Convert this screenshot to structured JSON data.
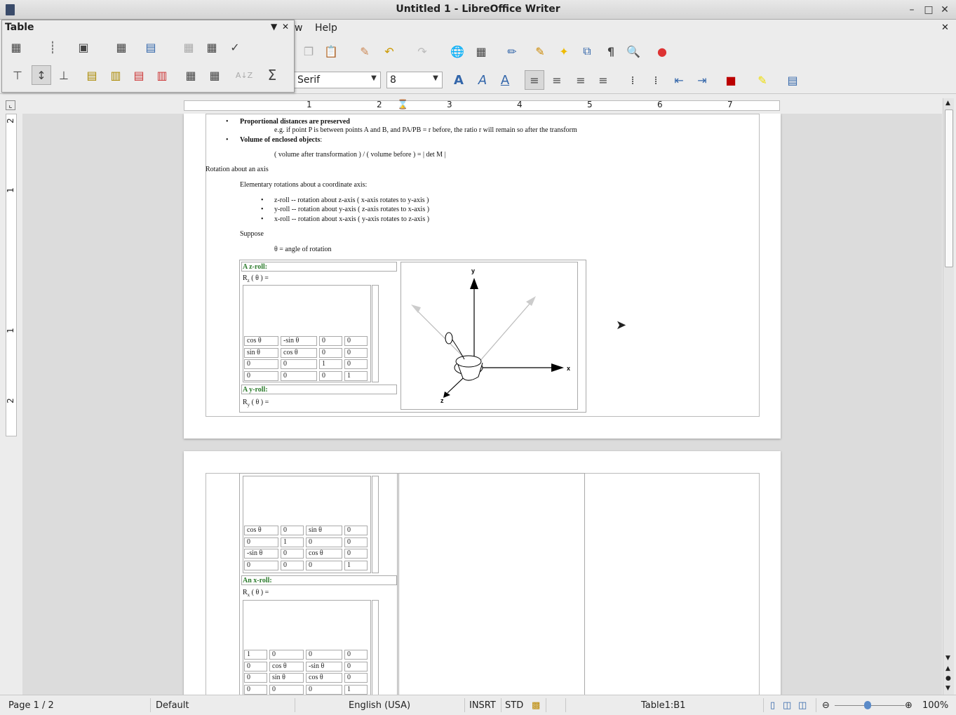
{
  "window": {
    "title": "Untitled 1 - LibreOffice Writer"
  },
  "menu": {
    "view_partial": "w",
    "help": "Help"
  },
  "table_panel": {
    "title": "Table"
  },
  "format": {
    "font_name": "Serif",
    "font_size": "8"
  },
  "ruler": {
    "h_ticks": [
      "1",
      "2",
      "3",
      "4",
      "5",
      "6",
      "7"
    ],
    "v_ticks": [
      "2",
      "1",
      "1",
      "2"
    ]
  },
  "doc": {
    "bullet1": "Proportional distances are preserved",
    "bullet1_sub": "e.g. if point P is between points A and B, and PA/PB = r before, the ratio r will remain so after the transform",
    "bullet2": "Volume of enclosed objects",
    "bullet2_colon": ":",
    "volume_formula": "( volume after transformation ) / ( volume before ) = | det M |",
    "heading_rotation": "Rotation about an axis",
    "elementary": "Elementary rotations about a coordinate axis:",
    "roll_z": "z-roll -- rotation about z-axis ( x-axis rotates to y-axis )",
    "roll_y": "y-roll -- rotation about y-axis ( z-axis rotates to x-axis )",
    "roll_x": "x-roll -- rotation about x-axis ( y-axis rotates to z-axis )",
    "suppose": "Suppose",
    "theta_def": "θ = angle of rotation",
    "zroll_title": "A z-roll:",
    "rz_label": "R",
    "rz_sub": "z",
    "rz_rest": " ( θ ) =",
    "yroll_title": "A y-roll:",
    "ry_label": "R",
    "ry_sub": "y",
    "ry_rest": " ( θ ) =",
    "xroll_title": "An x-roll:",
    "rx_label": "R",
    "rx_sub": "x",
    "rx_rest": " ( θ ) =",
    "axis_x": "x",
    "axis_y": "y",
    "axis_z": "z",
    "z_matrix": [
      [
        "cos θ",
        "-sin θ",
        "0",
        "0"
      ],
      [
        "sin θ",
        "cos θ",
        "0",
        "0"
      ],
      [
        "0",
        "0",
        "1",
        "0"
      ],
      [
        "0",
        "0",
        "0",
        "1"
      ]
    ],
    "y_matrix": [
      [
        "cos θ",
        "0",
        "sin θ",
        "0"
      ],
      [
        "0",
        "1",
        "0",
        "0"
      ],
      [
        "-sin θ",
        "0",
        "cos θ",
        "0"
      ],
      [
        "0",
        "0",
        "0",
        "1"
      ]
    ],
    "x_matrix": [
      [
        "1",
        "0",
        "0",
        "0"
      ],
      [
        "0",
        "cos θ",
        "-sin θ",
        "0"
      ],
      [
        "0",
        "sin θ",
        "cos θ",
        "0"
      ],
      [
        "0",
        "0",
        "0",
        "1"
      ]
    ]
  },
  "status": {
    "page": "Page 1 / 2",
    "style": "Default",
    "language": "English (USA)",
    "insert_mode": "INSRT",
    "sel_mode": "STD",
    "table_cell": "Table1:B1",
    "zoom": "100%"
  }
}
